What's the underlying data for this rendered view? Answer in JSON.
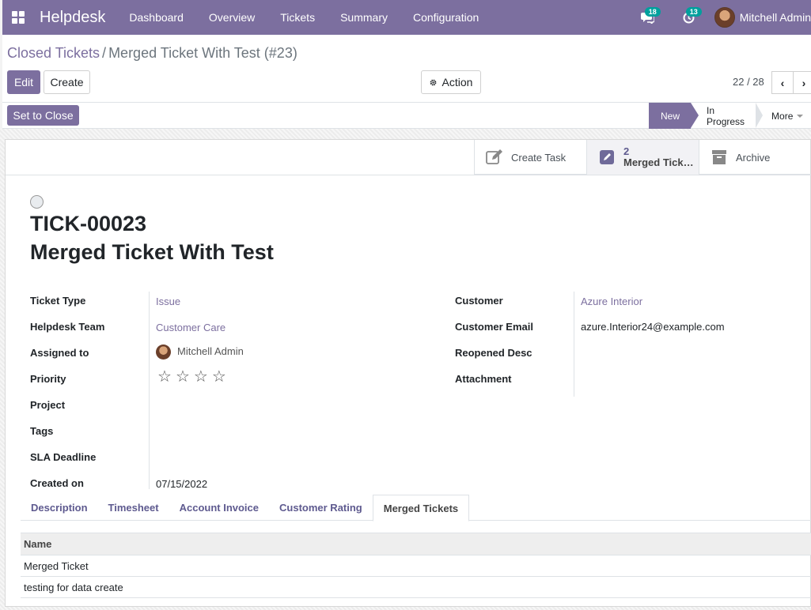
{
  "navbar": {
    "brand": "Helpdesk",
    "menu": [
      "Dashboard",
      "Overview",
      "Tickets",
      "Summary",
      "Configuration"
    ],
    "messages_count": "18",
    "activities_count": "13",
    "user_name": "Mitchell Admin",
    "icons": [
      "apps-icon",
      "chat-icon",
      "clock-icon"
    ]
  },
  "breadcrumb": {
    "parent": "Closed Tickets",
    "separator": "/",
    "current": "Merged Ticket With Test (#23)"
  },
  "toolbar": {
    "edit_label": "Edit",
    "create_label": "Create",
    "action_label": "Action",
    "pager": "22 / 28"
  },
  "statusbar": {
    "set_to_close_label": "Set to Close",
    "stages": [
      "New",
      "In Progress",
      "More"
    ],
    "active_stage": "New"
  },
  "smart_buttons": {
    "create_task": "Create Task",
    "merged_count": "2",
    "merged_label": "Merged Tick…",
    "archive": "Archive"
  },
  "ticket": {
    "reference": "TICK-00023",
    "title": "Merged Ticket With Test"
  },
  "fields_left": {
    "ticket_type_label": "Ticket Type",
    "ticket_type_value": "Issue",
    "team_label": "Helpdesk Team",
    "team_value": "Customer Care",
    "assigned_label": "Assigned to",
    "assigned_value": "Mitchell Admin",
    "priority_label": "Priority",
    "priority_stars": 0,
    "priority_max": 4,
    "project_label": "Project",
    "tags_label": "Tags",
    "sla_label": "SLA Deadline",
    "created_label": "Created on",
    "created_value": "07/15/2022"
  },
  "fields_right": {
    "customer_label": "Customer",
    "customer_value": "Azure Interior",
    "email_label": "Customer Email",
    "email_value": "azure.Interior24@example.com",
    "reopened_label": "Reopened Desc",
    "attachment_label": "Attachment"
  },
  "tabs": [
    "Description",
    "Timesheet",
    "Account Invoice",
    "Customer Rating",
    "Merged Tickets"
  ],
  "active_tab": "Merged Tickets",
  "merged_table": {
    "header": "Name",
    "rows": [
      "Merged Ticket",
      "testing for data create"
    ]
  },
  "colors": {
    "primary": "#7c6f9f",
    "link": "#7c6f9f",
    "badge": "#00a09d"
  }
}
